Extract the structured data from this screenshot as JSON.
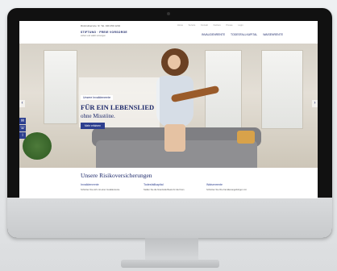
{
  "header": {
    "topline": "Rückrufservice ☏  Tel. 040 450 1234",
    "logo_line1": "STIFTUNG · FREIE VORSORGE",
    "logo_line2": "sicher und stabil vorsorgen",
    "top_nav": [
      "Home",
      "Service",
      "Kontakt",
      "Karriere",
      "Presse",
      "Login"
    ],
    "main_nav": [
      "INVALIDENRENTE",
      "TODESFALLKAPITAL",
      "WAISENRENTE"
    ]
  },
  "hero": {
    "tag": "Unsere Invalidenrente",
    "headline_line1": "FÜR EIN LEBENSLIED",
    "headline_line2": "ohne Misstöne.",
    "button": "Mehr erfahren",
    "prev": "‹",
    "next": "›",
    "side_icons": [
      "mail-icon",
      "phone-icon",
      "info-icon"
    ]
  },
  "section": {
    "title": "Unsere Risikoversicherungen",
    "columns": [
      {
        "heading": "Invalidenrente",
        "text": "Schützen Sie sich mit einer Invalidenrente"
      },
      {
        "heading": "Todesfallkapital",
        "text": "Stellen Sie die finanzielle Basis für die Ihren"
      },
      {
        "heading": "Waisenrente",
        "text": "Schützen Sie Ihre Familienangehörigen mit"
      }
    ]
  }
}
